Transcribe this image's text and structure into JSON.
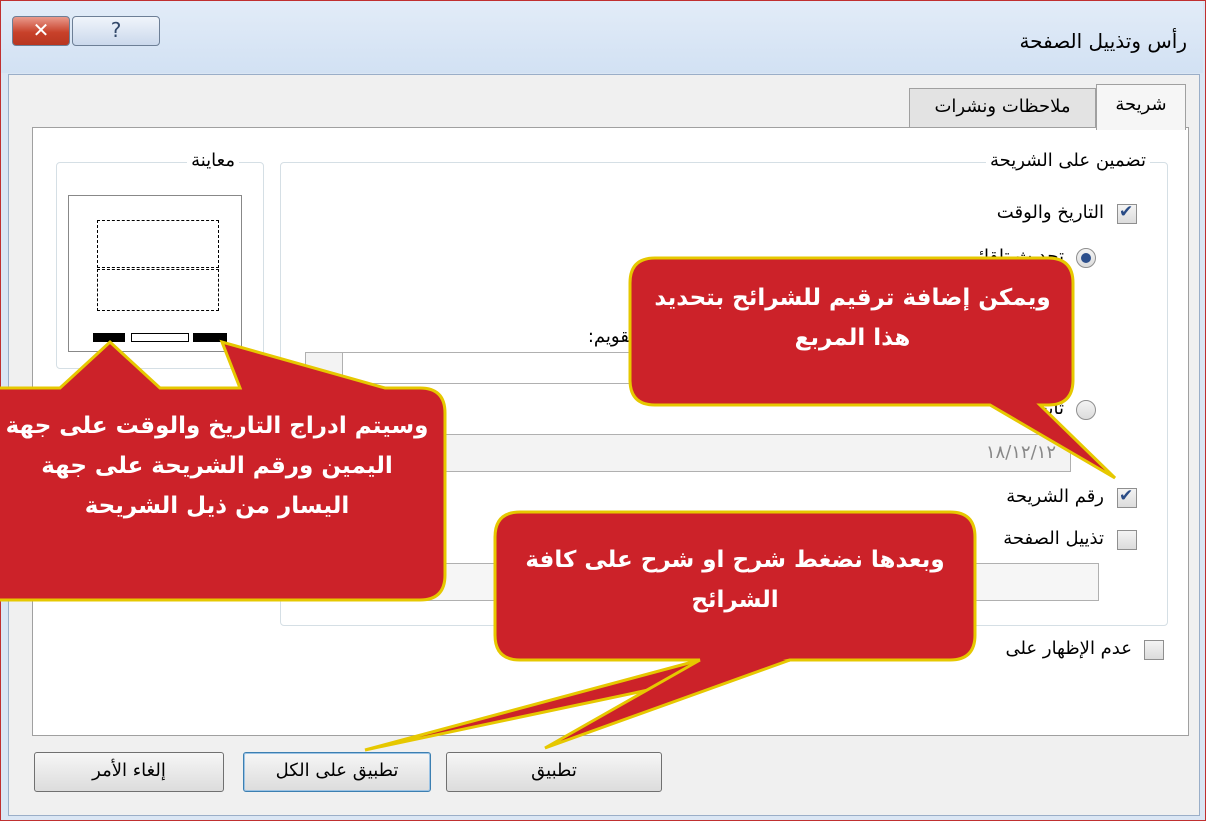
{
  "dialog": {
    "title": "رأس وتذييل الصفحة",
    "close_label": "✕",
    "help_label": "?",
    "tabs": [
      {
        "label": "شريحة",
        "active": true
      },
      {
        "label": "ملاحظات ونشرات",
        "active": false
      }
    ]
  },
  "include": {
    "legend": "تضمين على الشريحة",
    "date_time": {
      "label": "التاريخ والوقت",
      "checked": true
    },
    "auto_update": {
      "label": "تحديث تلقائي",
      "selected": true
    },
    "calendar_label": "نوع التقويم:",
    "fixed": {
      "label": "ثابت",
      "selected": false,
      "value": "١٨/١٢/١٢"
    },
    "slide_number": {
      "label": "رقم الشريحة",
      "checked": true
    },
    "footer": {
      "label": "تذييل الصفحة",
      "checked": false
    },
    "dont_show_title": {
      "label": "عدم الإظهار على",
      "checked": false
    }
  },
  "preview": {
    "legend": "معاينة"
  },
  "buttons": {
    "apply": "تطبيق",
    "apply_all": "تطبيق على الكل",
    "cancel": "إلغاء الأمر"
  },
  "callouts": {
    "slide_number_tip": "ويمكن إضافة ترقيم للشرائح بتحديد هذا المربع",
    "placement_tip": "وسيتم ادراج التاريخ والوقت على جهة اليمين ورقم الشريحة على جهة اليسار من ذيل الشريحة",
    "apply_tip": "وبعدها نضغط شرح او شرح على كافة الشرائح"
  },
  "colors": {
    "callout_fill": "#cc2229",
    "callout_border": "#e6c800",
    "accent": "#2c4f8c"
  }
}
